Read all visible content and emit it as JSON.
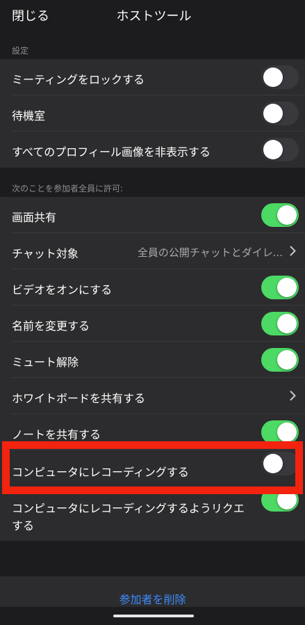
{
  "header": {
    "close_label": "閉じる",
    "title": "ホストツール"
  },
  "sections": {
    "settings_header": "設定",
    "allow_header": "次のことを参加者全員に許可:"
  },
  "rows": {
    "lock_meeting": {
      "label": "ミーティングをロックする",
      "on": false
    },
    "waiting_room": {
      "label": "待機室",
      "on": false
    },
    "hide_profile_pics": {
      "label": "すべてのプロフィール画像を非表示する",
      "on": false
    },
    "share_screen": {
      "label": "画面共有",
      "on": true
    },
    "chat_with": {
      "label": "チャット対象",
      "value": "全員の公開チャットとダイレ..."
    },
    "start_video": {
      "label": "ビデオをオンにする",
      "on": true
    },
    "rename": {
      "label": "名前を変更する",
      "on": true
    },
    "unmute": {
      "label": "ミュート解除",
      "on": true
    },
    "share_whiteboard": {
      "label": "ホワイトボードを共有する"
    },
    "share_notes": {
      "label": "ノートを共有する",
      "on": true
    },
    "record_local": {
      "label": "コンピュータにレコーディングする",
      "on": false
    },
    "request_record_line1": "コンピュータにレコーディングするようリクエ",
    "request_record_line2": "する"
  },
  "footer": {
    "remove_label": "参加者を削除"
  },
  "colors": {
    "toggle_on": "#4cd964",
    "highlight": "#f2230f",
    "link_blue": "#3d8bfd"
  }
}
